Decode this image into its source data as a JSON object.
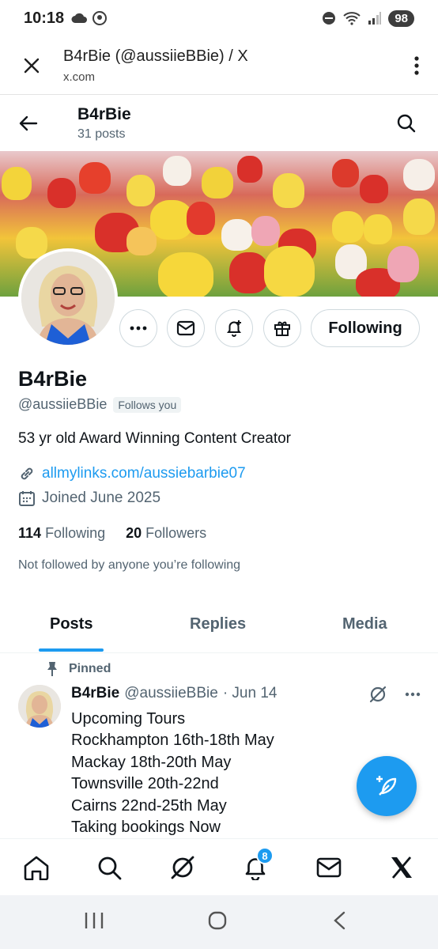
{
  "status_bar": {
    "time": "10:18",
    "battery": "98"
  },
  "browser": {
    "page_title": "B4rBie (@aussiieBBie) / X",
    "url": "x.com"
  },
  "profile_header": {
    "name": "B4rBie",
    "post_count": "31 posts"
  },
  "profile": {
    "display_name": "B4rBie",
    "handle": "@aussiieBBie",
    "follows_you": "Follows you",
    "bio": "53 yr old Award Winning Content Creator",
    "link": "allmylinks.com/aussiebarbie07",
    "joined": "Joined June 2025",
    "following_count": "114",
    "following_label": "Following",
    "followers_count": "20",
    "followers_label": "Followers",
    "not_followed": "Not followed by anyone you’re following",
    "follow_button": "Following"
  },
  "tabs": [
    "Posts",
    "Replies",
    "Media"
  ],
  "pinned_post": {
    "pinned_label": "Pinned",
    "author": "B4rBie",
    "handle": "@aussiieBBie",
    "date": "· Jun 14",
    "lines": [
      "Upcoming Tours",
      "Rockhampton 16th-18th May",
      "Mackay 18th-20th May",
      "Townsville 20th-22nd",
      "Cairns 22nd-25th May",
      "Taking bookings Now"
    ]
  },
  "bottom_nav": {
    "notifications_badge": "8"
  },
  "colors": {
    "accent": "#1d9bf0",
    "text": "#0f1419",
    "secondary": "#536471"
  }
}
